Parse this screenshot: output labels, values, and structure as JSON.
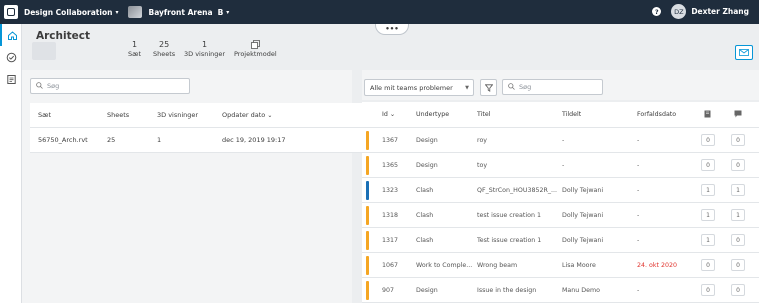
{
  "topbar": {
    "app_name": "Design Collaboration",
    "project_name": "Bayfront Arena",
    "project_badge": "B",
    "help_label": "?",
    "avatar_initials": "DZ",
    "user_name": "Dexter Zhang"
  },
  "header": {
    "title": "Architect",
    "stats": [
      {
        "num": "1",
        "label": "Sæt"
      },
      {
        "num": "25",
        "label": "Sheets"
      },
      {
        "num": "1",
        "label": "3D visninger"
      },
      {
        "num": "",
        "label": "Projektmodel"
      }
    ],
    "collapse_label": "•••"
  },
  "left": {
    "search_placeholder": "Søg",
    "columns": [
      "Sæt",
      "Sheets",
      "3D visninger",
      "Opdater dato"
    ],
    "rows": [
      {
        "set": "56750_Arch.rvt",
        "sheets": "25",
        "views": "1",
        "date": "dec 19, 2019 19:17"
      }
    ]
  },
  "right": {
    "filter_value": "Alle mit teams problemer",
    "search_placeholder": "Søg",
    "columns": [
      "Id",
      "Undertype",
      "Titel",
      "Tildelt",
      "Forfaldsdato"
    ],
    "rows": [
      {
        "id": "1367",
        "type": "Design",
        "title": "roy",
        "assigned": "-",
        "due": "-",
        "c1": "0",
        "c2": "0",
        "color": "#f5a623"
      },
      {
        "id": "1365",
        "type": "Design",
        "title": "toy",
        "assigned": "-",
        "due": "-",
        "c1": "0",
        "c2": "0",
        "color": "#f5a623"
      },
      {
        "id": "1323",
        "type": "Clash",
        "title": "QF_StrCon_HOU3852R_...",
        "assigned": "Dolly Tejwani",
        "due": "-",
        "c1": "1",
        "c2": "1",
        "color": "#1a6fb5"
      },
      {
        "id": "1318",
        "type": "Clash",
        "title": "test issue creation 1",
        "assigned": "Dolly Tejwani",
        "due": "-",
        "c1": "1",
        "c2": "1",
        "color": "#f5a623"
      },
      {
        "id": "1317",
        "type": "Clash",
        "title": "Test issue creation 1",
        "assigned": "Dolly Tejwani",
        "due": "-",
        "c1": "1",
        "c2": "0",
        "color": "#f5a623"
      },
      {
        "id": "1067",
        "type": "Work to Comple...",
        "title": "Wrong beam",
        "assigned": "Lisa Moore",
        "due": "24. okt 2020",
        "c1": "0",
        "c2": "0",
        "color": "#f5a623",
        "due_color": "#e0312b"
      },
      {
        "id": "907",
        "type": "Design",
        "title": "Issue in the design",
        "assigned": "Manu Demo",
        "due": "-",
        "c1": "0",
        "c2": "0",
        "color": "#f5a623"
      }
    ]
  }
}
